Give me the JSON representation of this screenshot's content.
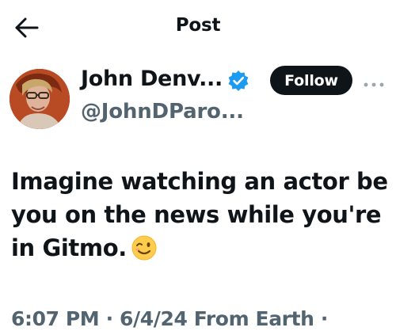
{
  "header": {
    "title": "Post",
    "back_icon": "arrow-left-icon"
  },
  "author": {
    "display_name": "John Denv...",
    "handle": "@JohnDParo...",
    "verified_icon": "verified-badge-icon",
    "verified_color": "#1d9bf0",
    "avatar_icon": "avatar-photo"
  },
  "actions": {
    "follow_label": "Follow",
    "more_icon": "more-options-icon"
  },
  "post": {
    "text": "Imagine watching an actor be you on the news while you're in Gitmo.",
    "emoji": "😉",
    "emoji_icon": "winking-face-icon"
  },
  "meta": {
    "time": "6:07 PM",
    "separator": " · ",
    "date": "6/4/24",
    "location": "From Earth",
    "trailing_separator": " ·"
  },
  "colors": {
    "text_primary": "#0f1419",
    "text_secondary": "#536471",
    "button_bg": "#0f1419",
    "button_text": "#ffffff"
  }
}
